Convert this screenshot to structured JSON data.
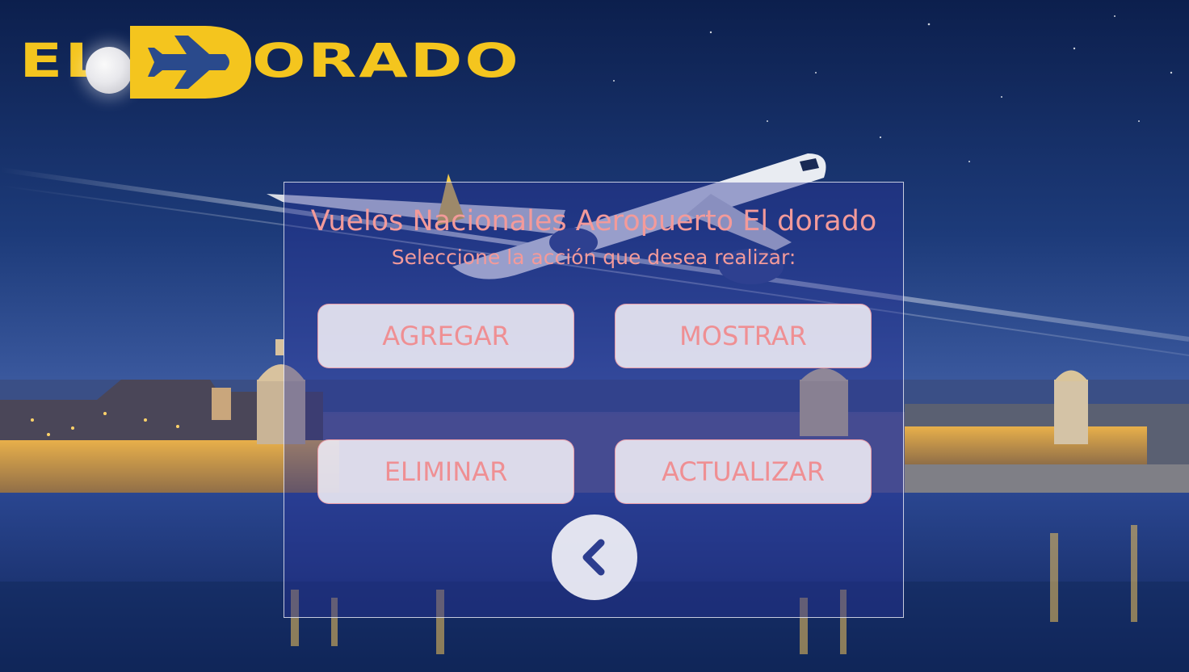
{
  "brand": {
    "logo_left": "EL",
    "logo_right": "ORADO",
    "logo_color": "#f4c51e"
  },
  "panel": {
    "title": "Vuelos Nacionales Aeropuerto El dorado",
    "subtitle": "Seleccione la acción que desea realizar:",
    "text_color": "#f39a9a"
  },
  "actions": {
    "add": "AGREGAR",
    "show": "MOSTRAR",
    "delete": "ELIMINAR",
    "update": "ACTUALIZAR"
  },
  "navigation": {
    "back_icon": "chevron-left-icon"
  },
  "colors": {
    "sky_top": "#0d2352",
    "sky_mid": "#2a4a8c",
    "water": "#1d3a7a",
    "panel_bg": "#28329680",
    "button_bg": "#eceaf4",
    "button_text": "#ef8f93"
  }
}
